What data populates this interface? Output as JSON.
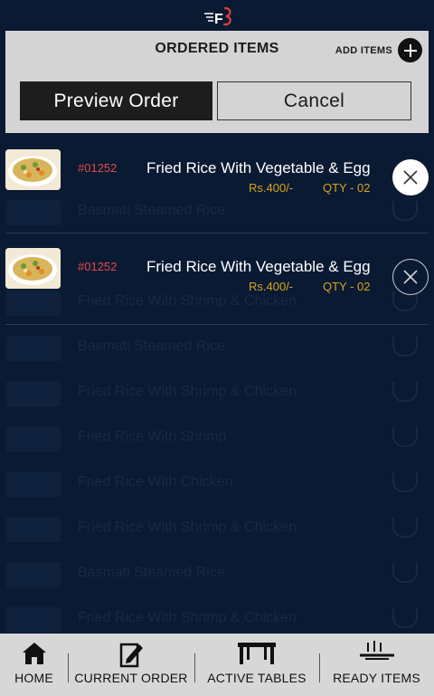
{
  "panel": {
    "title": "ORDERED ITEMS",
    "add_items_label": "ADD ITEMS",
    "preview_label": "Preview Order",
    "cancel_label": "Cancel"
  },
  "items": [
    {
      "code": "#01252",
      "name": "Fried Rice With Vegetable & Egg",
      "price": "Rs.400/-",
      "qty": "QTY - 02"
    },
    {
      "code": "#01252",
      "name": "Fried Rice With Vegetable & Egg",
      "price": "Rs.400/-",
      "qty": "QTY - 02"
    }
  ],
  "background_list": [
    "Basmati Steamed Rice",
    "Fried Rice With Shrimp & Chicken",
    "Basmati Steamed Rice",
    "Fried Rice With Shrimp & Chicken",
    "Fried Rice With Shrimp",
    "Fried Rice With Chicken",
    "Fried Rice With Shrimp & Chicken",
    "Basmati Steamed Rice",
    "Fried Rice With Shrimp & Chicken"
  ],
  "nav": {
    "home": "HOME",
    "current_order": "CURRENT ORDER",
    "active_tables": "ACTIVE TABLES",
    "ready_items": "READY ITEMS"
  },
  "colors": {
    "background": "#0b1a33",
    "panel": "#d4d4d4",
    "code": "#e24a4a",
    "price": "#d9a41e"
  }
}
